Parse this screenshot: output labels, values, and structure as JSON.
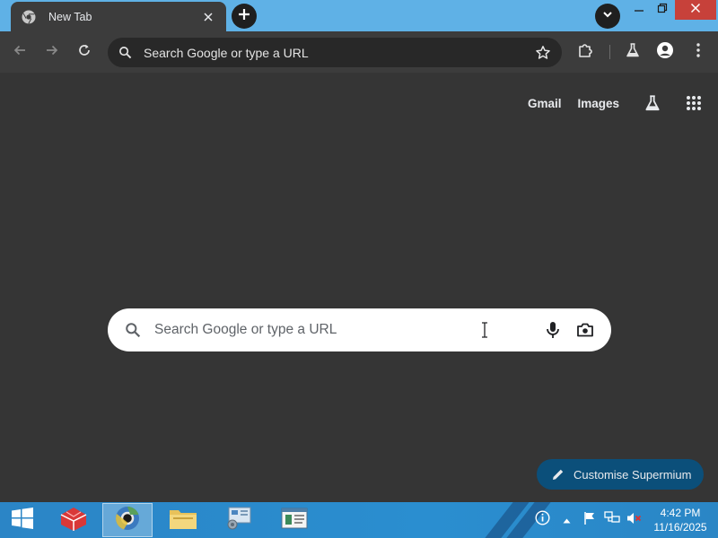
{
  "tab": {
    "title": "New Tab",
    "favicon": "chromium-icon"
  },
  "omnibox": {
    "placeholder": "Search Google or type a URL"
  },
  "ntp": {
    "links": {
      "gmail": "Gmail",
      "images": "Images"
    },
    "search": {
      "placeholder": "Search Google or type a URL"
    },
    "customise_label": "Customise Supermium"
  },
  "taskbar": {
    "time": "4:42 PM",
    "date": "11/16/2025",
    "apps": [
      "app-icon",
      "browser-icon",
      "file-explorer-icon",
      "control-panel-icon",
      "document-icon"
    ]
  },
  "colors": {
    "page_bg": "#353535",
    "tabstrip_bg": "#5fb1e6",
    "toolbar_bg": "#3c3c3c",
    "customise_bg": "#0b4f7a",
    "close_btn": "#c7413a"
  }
}
